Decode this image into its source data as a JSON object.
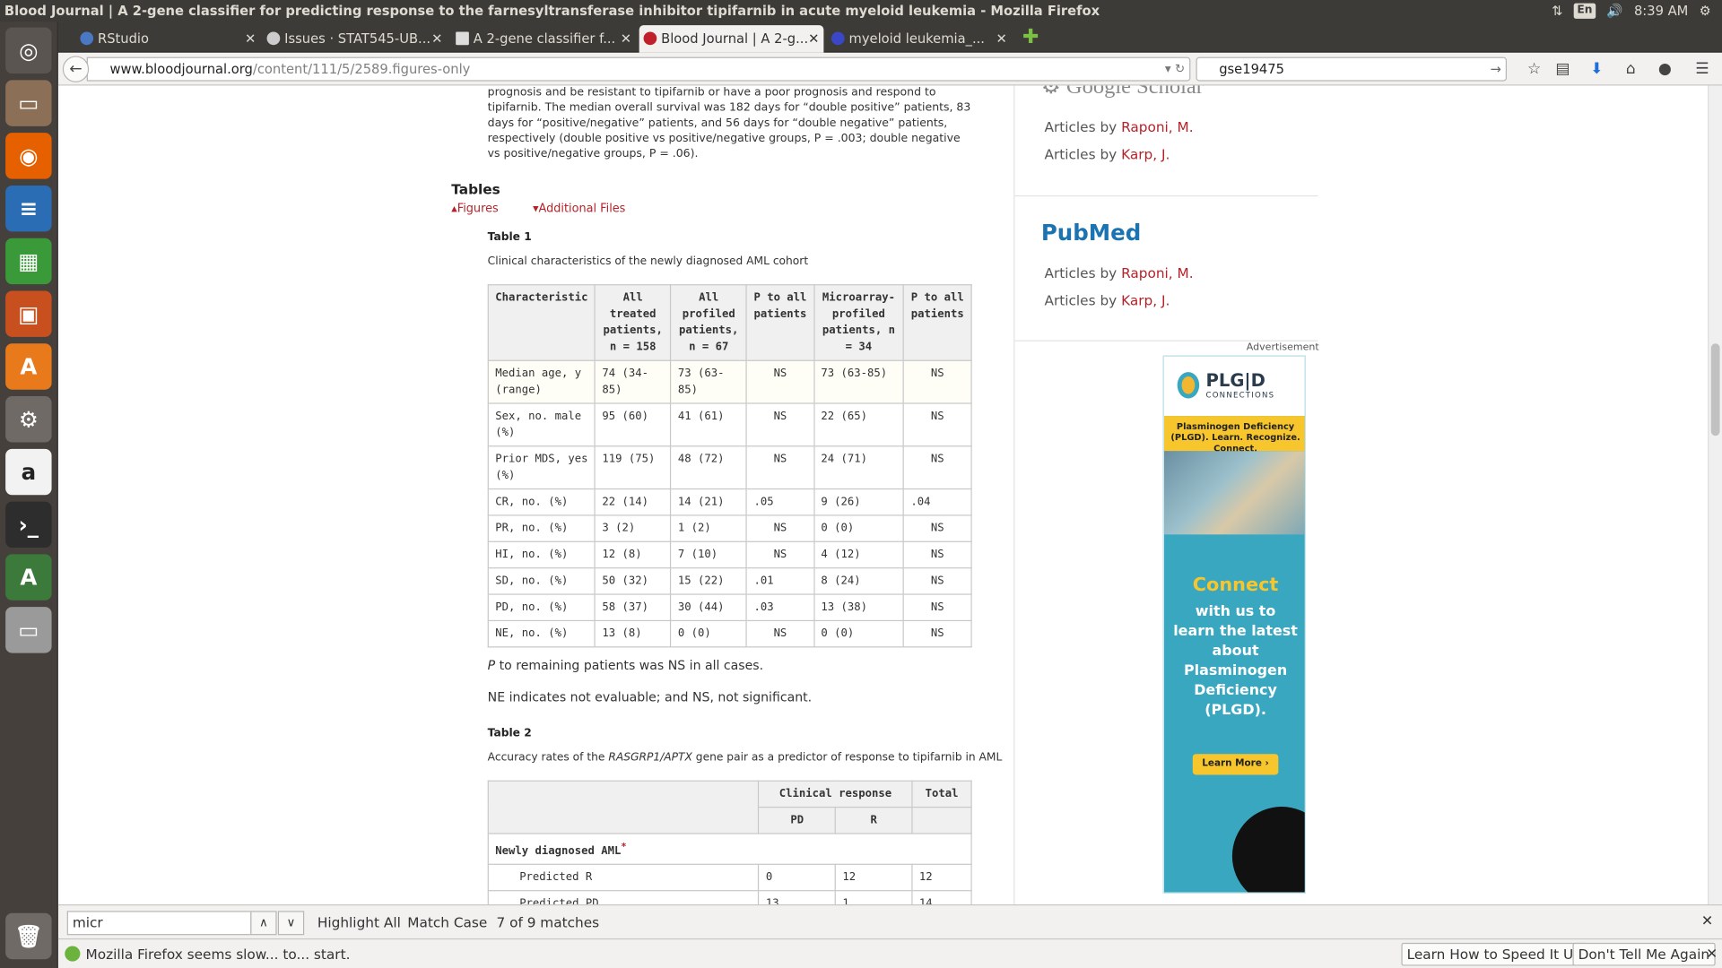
{
  "window_title": "Blood Journal | A 2-gene classifier for predicting response to the farnesyltransferase inhibitor tipifarnib in acute myeloid leukemia - Mozilla Firefox",
  "tray": {
    "lang": "En",
    "time": "8:39 AM"
  },
  "tabs": [
    {
      "label": "RStudio",
      "color": "#4a78c2"
    },
    {
      "label": "Issues · STAT545-UB...",
      "color": "#cccccc"
    },
    {
      "label": "A 2-gene classifier f...",
      "color": "#dddddd"
    },
    {
      "label": "Blood Journal | A 2-g...",
      "color": "#c0202a",
      "active": true
    },
    {
      "label": "myeloid leukemia_...",
      "color": "#3a48c8"
    }
  ],
  "nav": {
    "url_domain": "www.bloodjournal.org",
    "url_path": "/content/111/5/2589.figures-only",
    "search_value": "gse19475"
  },
  "figure_caption": "prognosis and be resistant to tipifarnib or have a poor prognosis and respond to tipifarnib. The median overall survival was 182 days for “double positive” patients, 83 days for “positive/negative” patients, and 56 days for “double negative” patients, respectively (double positive vs positive/negative groups, P = .003; double negative vs positive/negative groups, P = .06).",
  "tables_heading": "Tables",
  "toggles": {
    "figures": "Figures",
    "additional": "Additional Files"
  },
  "table1": {
    "label": "Table 1",
    "description": "Clinical characteristics of the newly diagnosed AML cohort",
    "headers": [
      "Characteristic",
      "All treated patients, n = 158",
      "All profiled patients, n = 67",
      "P to all patients",
      "Microarray-profiled patients, n = 34",
      "P to all patients"
    ],
    "rows": [
      [
        "Median age, y (range)",
        "74 (34-85)",
        "73 (63-85)",
        "NS",
        "73 (63-85)",
        "NS"
      ],
      [
        "Sex, no. male (%)",
        "95 (60)",
        "41 (61)",
        "NS",
        "22 (65)",
        "NS"
      ],
      [
        "Prior MDS, yes (%)",
        "119 (75)",
        "48 (72)",
        "NS",
        "24 (71)",
        "NS"
      ],
      [
        "CR, no. (%)",
        "22 (14)",
        "14 (21)",
        ".05",
        "9 (26)",
        ".04"
      ],
      [
        "PR, no. (%)",
        "3 (2)",
        "1 (2)",
        "NS",
        "0 (0)",
        "NS"
      ],
      [
        "HI, no. (%)",
        "12 (8)",
        "7 (10)",
        "NS",
        "4 (12)",
        "NS"
      ],
      [
        "SD, no. (%)",
        "50 (32)",
        "15 (22)",
        ".01",
        "8 (24)",
        "NS"
      ],
      [
        "PD, no. (%)",
        "58 (37)",
        "30 (44)",
        ".03",
        "13 (38)",
        "NS"
      ],
      [
        "NE, no. (%)",
        "13 (8)",
        "0 (0)",
        "NS",
        "0 (0)",
        "NS"
      ]
    ],
    "note1": "P to remaining patients was NS in all cases.",
    "note2": "NE indicates not evaluable; and NS, not significant."
  },
  "table2": {
    "label": "Table 2",
    "description_pre": "Accuracy rates of the ",
    "description_gene": "RASGRP1/APTX",
    "description_post": " gene pair as a predictor of response to tipifarnib in AML",
    "header_clinical": "Clinical response",
    "header_total": "Total",
    "sub_pd": "PD",
    "sub_r": "R",
    "section": "Newly diagnosed AML",
    "section_mark": "*",
    "rows": [
      [
        "Predicted R",
        "0",
        "12",
        "12"
      ],
      [
        "Predicted PD",
        "13",
        "1",
        "14"
      ]
    ]
  },
  "sidebar": {
    "gscholar": "Google Scholar",
    "articles_by": "Articles by",
    "author1": "Raponi, M.",
    "author2": "Karp, J.",
    "pubmed": "PubMed"
  },
  "ad": {
    "label": "Advertisement",
    "logo": "PLG|D",
    "logo_sub": "CONNECTIONS",
    "banner": "Plasminogen Deficiency (PLGD). Learn. Recognize. Connect.",
    "heading": "Connect",
    "body": "with us to learn the latest about Plasminogen Deficiency (PLGD).",
    "button": "Learn More"
  },
  "findbar": {
    "value": "micr",
    "highlight_all": "Highlight All",
    "match_case": "Match Case",
    "matches": "7 of 9 matches"
  },
  "notification": {
    "text": "Mozilla Firefox seems slow... to... start.",
    "btn1": "Learn How to Speed It Up",
    "btn2": "Don't Tell Me Again"
  }
}
